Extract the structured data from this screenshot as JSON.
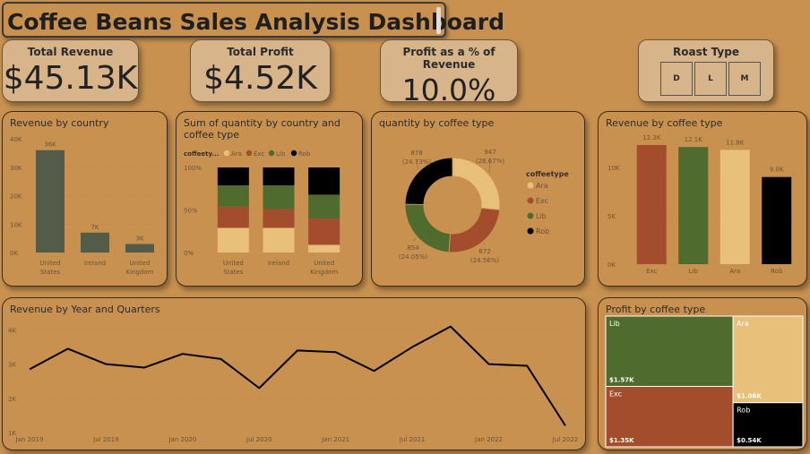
{
  "header": {
    "title": "Coffee Beans Sales Analysis Dashboard"
  },
  "kpis": {
    "total_revenue": {
      "label": "Total Revenue",
      "value": "$45.13K"
    },
    "total_profit": {
      "label": "Total Profit",
      "value": "$4.52K"
    },
    "profit_pct": {
      "label": "Profit as a % of Revenue",
      "value": "10.0%"
    }
  },
  "roast_type": {
    "label": "Roast Type",
    "options": [
      "D",
      "L",
      "M"
    ]
  },
  "colors": {
    "Ara": "#e8c07a",
    "Exc": "#a34d2c",
    "Lib": "#4f6b2d",
    "Rob": "#000000",
    "country_bar": "#535c48"
  },
  "revenue_by_country": {
    "title": "Revenue by country",
    "chart_data": {
      "type": "bar",
      "categories": [
        "United States",
        "Ireland",
        "United Kingdom"
      ],
      "category_lines": [
        [
          "United",
          "States"
        ],
        [
          "Ireland"
        ],
        [
          "United",
          "Kingdom"
        ]
      ],
      "values": [
        36,
        7,
        3
      ],
      "data_labels": [
        "36K",
        "7K",
        "3K"
      ],
      "yticks": [
        "0K",
        "10K",
        "20K",
        "30K",
        "40K"
      ],
      "ylim": [
        0,
        40
      ]
    }
  },
  "qty_country_type": {
    "title_line1": "Sum of quantity by country and",
    "title_line2": "coffee type",
    "legend_title": "coffeety...",
    "chart_data": {
      "type": "bar",
      "stacked": "100%",
      "categories": [
        "United States",
        "Ireland",
        "United Kingdom"
      ],
      "category_lines": [
        [
          "United",
          "States"
        ],
        [
          "Ireland"
        ],
        [
          "United",
          "Kingdom"
        ]
      ],
      "yticks": [
        "0%",
        "50%",
        "100%"
      ],
      "series": [
        {
          "name": "Ara",
          "values": [
            0.29,
            0.29,
            0.09
          ]
        },
        {
          "name": "Exc",
          "values": [
            0.25,
            0.22,
            0.31
          ]
        },
        {
          "name": "Lib",
          "values": [
            0.25,
            0.28,
            0.28
          ]
        },
        {
          "name": "Rob",
          "values": [
            0.21,
            0.21,
            0.32
          ]
        }
      ]
    }
  },
  "qty_coffee_type": {
    "title": "quantity by coffee type",
    "legend_title": "coffeetype",
    "chart_data": {
      "type": "pie",
      "donut": true,
      "series": [
        {
          "name": "Ara",
          "value": 947,
          "label": "947",
          "pct": "(26.67%)"
        },
        {
          "name": "Exc",
          "value": 872,
          "label": "872",
          "pct": "(24.56%)"
        },
        {
          "name": "Lib",
          "value": 854,
          "label": "854",
          "pct": "(24.05%)"
        },
        {
          "name": "Rob",
          "value": 878,
          "label": "878",
          "pct": "(24.73%)"
        }
      ]
    }
  },
  "revenue_coffee_type": {
    "title": "Revenue by coffee type",
    "chart_data": {
      "type": "bar",
      "categories": [
        "Exc",
        "Lib",
        "Ara",
        "Rob"
      ],
      "values": [
        12.3,
        12.1,
        11.8,
        9.0
      ],
      "data_labels": [
        "12.3K",
        "12.1K",
        "11.8K",
        "9.0K"
      ],
      "yticks": [
        "0K",
        "5K",
        "10K"
      ],
      "ylim": [
        0,
        13.5
      ]
    }
  },
  "revenue_year_quarters": {
    "title": "Revenue by Year and Quarters",
    "chart_data": {
      "type": "line",
      "x": [
        "2019Q1",
        "2019Q2",
        "2019Q3",
        "2019Q4",
        "2020Q1",
        "2020Q2",
        "2020Q3",
        "2020Q4",
        "2021Q1",
        "2021Q2",
        "2021Q3",
        "2021Q4",
        "2022Q1",
        "2022Q2",
        "2022Q3"
      ],
      "values": [
        2.85,
        3.45,
        3.0,
        2.9,
        3.3,
        3.15,
        2.3,
        3.4,
        3.35,
        2.8,
        3.5,
        4.1,
        3.0,
        2.95,
        1.2
      ],
      "xticks": [
        "Jan 2019",
        "Jul 2019",
        "Jan 2020",
        "Jul 2020",
        "Jan 2021",
        "Jul 2021",
        "Jan 2022",
        "Jul 2022"
      ],
      "yticks": [
        "1K",
        "2K",
        "3K",
        "4K"
      ],
      "ylim": [
        1,
        4.3
      ]
    }
  },
  "profit_coffee_type": {
    "title": "Profit by coffee type",
    "chart_data": {
      "type": "treemap",
      "series": [
        {
          "name": "Lib",
          "value": 1.57,
          "label": "$1.57K"
        },
        {
          "name": "Exc",
          "value": 1.35,
          "label": "$1.35K"
        },
        {
          "name": "Ara",
          "value": 1.06,
          "label": "$1.06K"
        },
        {
          "name": "Rob",
          "value": 0.54,
          "label": "$0.54K"
        }
      ]
    }
  }
}
